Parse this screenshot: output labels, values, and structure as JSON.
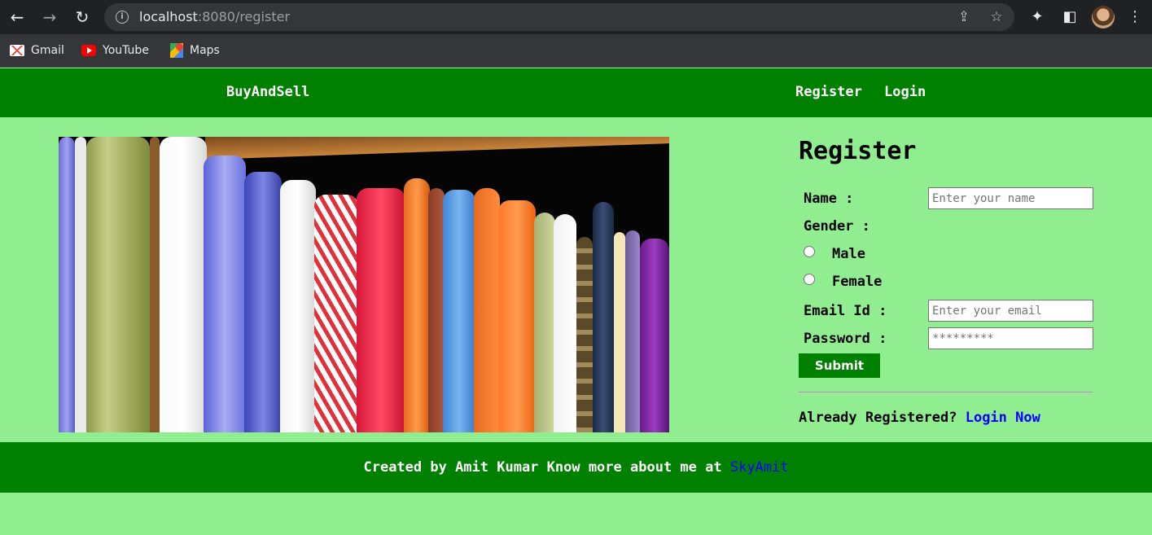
{
  "browser": {
    "url_host": "localhost",
    "url_rest": ":8080/register",
    "bookmarks": [
      {
        "label": "Gmail",
        "icon": "gmail-icon"
      },
      {
        "label": "YouTube",
        "icon": "youtube-icon"
      },
      {
        "label": "Maps",
        "icon": "maps-icon"
      }
    ]
  },
  "header": {
    "brand": "BuyAndSell",
    "nav": [
      "Register",
      "Login"
    ],
    "bg_color": "#008000"
  },
  "hero": {
    "image": "books-on-shelf"
  },
  "form": {
    "title": "Register",
    "name_label": "Name :",
    "name_placeholder": "Enter your name",
    "gender_label": "Gender :",
    "gender_options": [
      "Male",
      "Female"
    ],
    "email_label": "Email Id :",
    "email_placeholder": "Enter your email",
    "password_label": "Password :",
    "password_placeholder": "*********",
    "submit_label": "Submit",
    "already_text": "Already Registered?",
    "login_link": "Login Now"
  },
  "footer": {
    "text": "Created by Amit Kumar Know more about me at",
    "link": "SkyAmit"
  },
  "colors": {
    "page_bg": "#90ee90",
    "accent_green": "#008000",
    "link_blue": "#0000ff"
  }
}
